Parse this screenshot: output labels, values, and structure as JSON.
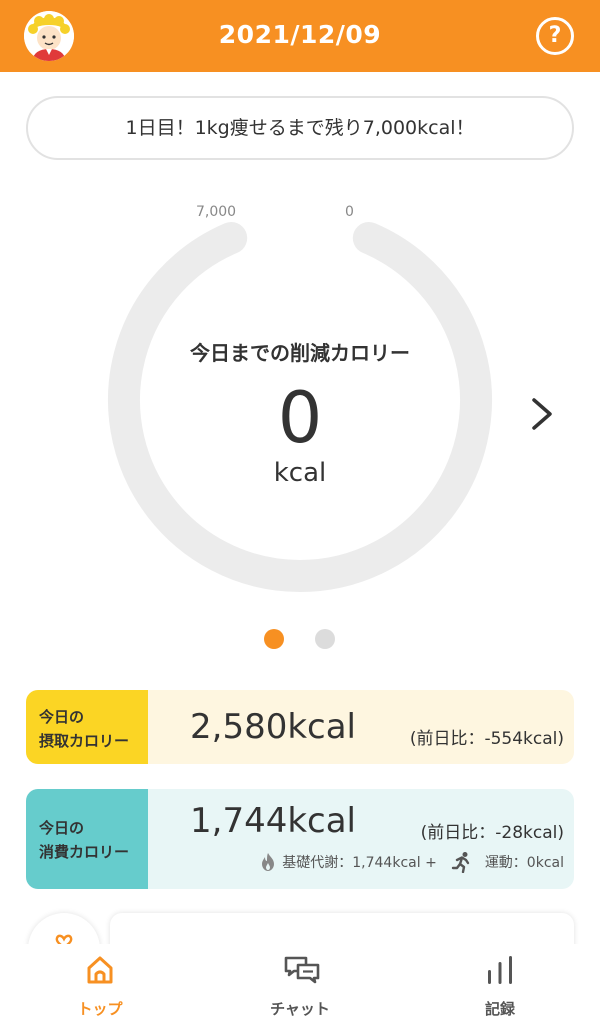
{
  "header": {
    "date": "2021/12/09",
    "help_symbol": "?",
    "avatar_icon": "user-avatar-icon",
    "accent_color": "#f79022"
  },
  "goal_banner": {
    "text": "1日目！1kg痩せるまで残り7,000kcal！"
  },
  "gauge": {
    "start_label": "7,000",
    "end_label": "0",
    "title": "今日までの削減カロリー",
    "value": "0",
    "unit": "kcal",
    "progress": 0
  },
  "pager": {
    "active_index": 0,
    "count": 2
  },
  "intake": {
    "tag_line1": "今日の",
    "tag_line2": "摂取カロリー",
    "value": "2,580kcal",
    "diff": "(前日比：-554kcal)",
    "color": "#fbd524"
  },
  "burn": {
    "tag_line1": "今日の",
    "tag_line2": "消費カロリー",
    "value": "1,744kcal",
    "diff": "(前日比：-28kcal)",
    "basal": "基礎代謝：1,744kcal +",
    "exercise": "運動：0kcal",
    "color": "#66cccc"
  },
  "tabs": [
    {
      "label": "トップ",
      "icon": "home-icon",
      "active": true
    },
    {
      "label": "チャット",
      "icon": "chat-icon",
      "active": false
    },
    {
      "label": "記録",
      "icon": "bar-chart-icon",
      "active": false
    }
  ]
}
